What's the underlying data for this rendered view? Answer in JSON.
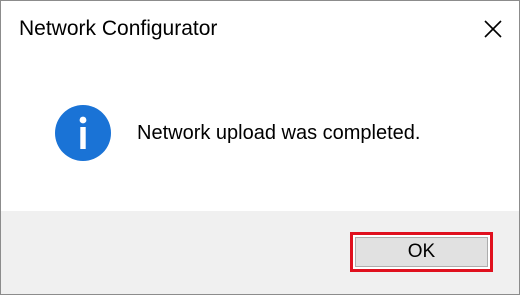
{
  "window": {
    "title": "Network Configurator",
    "close_icon": "close-icon"
  },
  "message": {
    "icon": "info-icon",
    "text": "Network upload was completed."
  },
  "footer": {
    "ok_label": "OK"
  },
  "colors": {
    "info_icon": "#1a73d6",
    "highlight_border": "#e0101e",
    "footer_bg": "#f0f0f0",
    "button_bg": "#e1e1e1"
  }
}
